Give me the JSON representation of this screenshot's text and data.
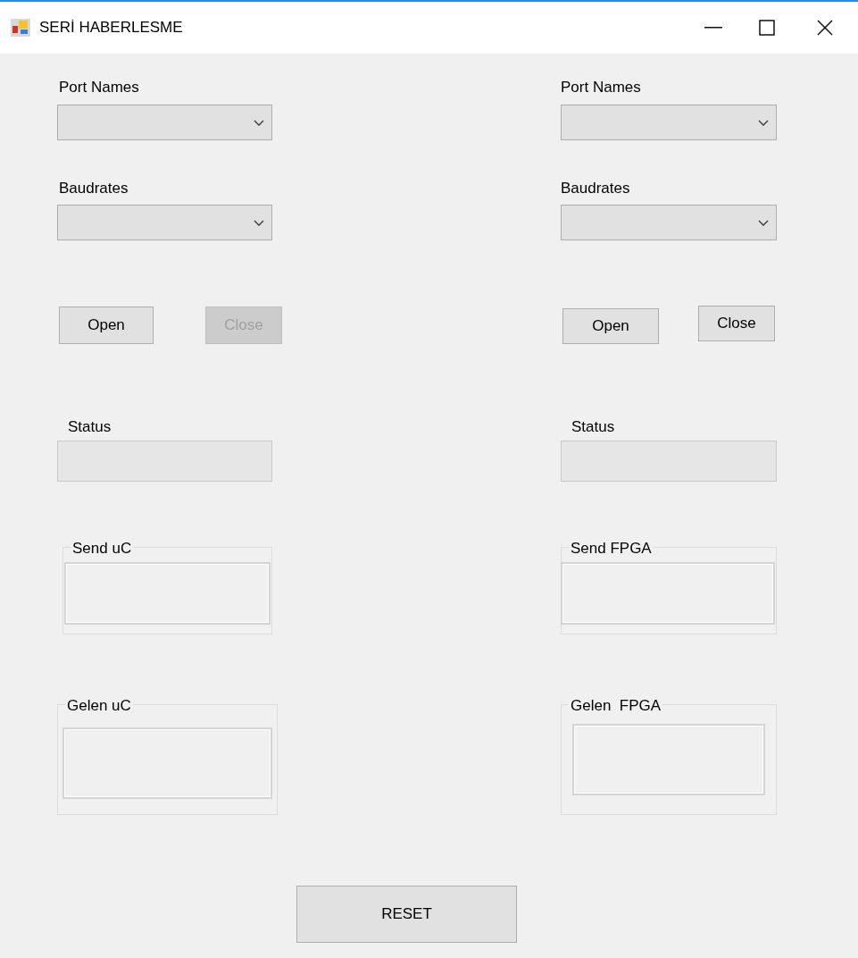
{
  "window": {
    "title": "SERİ HABERLESME"
  },
  "panels": [
    {
      "port_label": "Port Names",
      "baud_label": "Baudrates",
      "open_button": {
        "label": "Open",
        "disabled": false
      },
      "close_button": {
        "label": "Close",
        "disabled": true
      },
      "status_label": "Status",
      "send_group": "Send uC",
      "receive_group": "Gelen uC"
    },
    {
      "port_label": "Port Names",
      "baud_label": "Baudrates",
      "open_button": {
        "label": "Open",
        "disabled": false
      },
      "close_button": {
        "label": "Close",
        "disabled": false
      },
      "status_label": "Status",
      "send_group": "Send FPGA",
      "receive_group": "Gelen  FPGA"
    }
  ],
  "reset_button": {
    "label": "RESET"
  }
}
